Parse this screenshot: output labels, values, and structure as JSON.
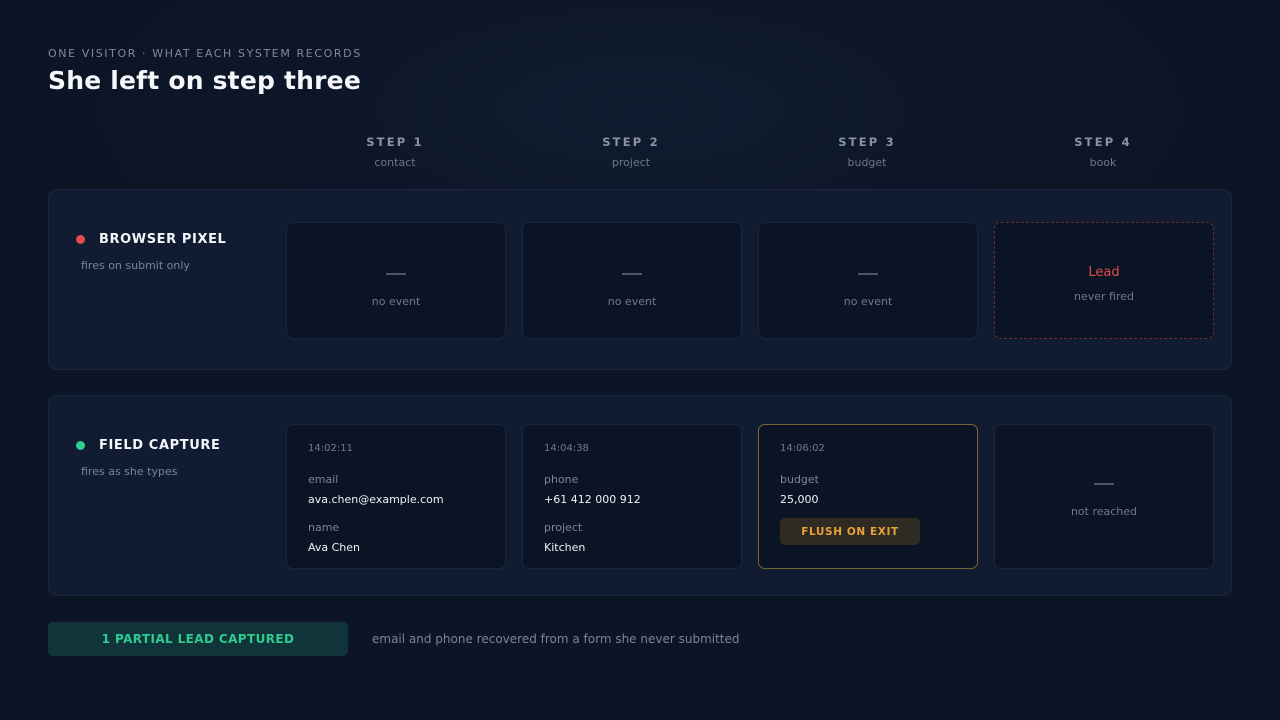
{
  "header": {
    "eyebrow": "ONE VISITOR · WHAT EACH SYSTEM RECORDS",
    "title": "She left on step three"
  },
  "steps": [
    {
      "label": "STEP 1",
      "name": "contact"
    },
    {
      "label": "STEP 2",
      "name": "project"
    },
    {
      "label": "STEP 3",
      "name": "budget"
    },
    {
      "label": "STEP 4",
      "name": "book"
    }
  ],
  "browser_pixel": {
    "name": "BROWSER PIXEL",
    "desc": "fires on submit only",
    "status_color": "#e04b4b",
    "cells": [
      {
        "dash": "—",
        "text": "no event"
      },
      {
        "dash": "—",
        "text": "no event"
      },
      {
        "dash": "—",
        "text": "no event"
      },
      {
        "event": "Lead",
        "text": "never fired"
      }
    ]
  },
  "field_capture": {
    "name": "FIELD CAPTURE",
    "desc": "fires as she types",
    "status_color": "#2ecc8f",
    "cells": [
      {
        "time": "14:02:11",
        "fields": [
          {
            "label": "email",
            "value": "ava.chen@example.com"
          },
          {
            "label": "name",
            "value": "Ava Chen"
          }
        ]
      },
      {
        "time": "14:04:38",
        "fields": [
          {
            "label": "phone",
            "value": "+61 412 000 912"
          },
          {
            "label": "project",
            "value": "Kitchen"
          }
        ]
      },
      {
        "time": "14:06:02",
        "fields": [
          {
            "label": "budget",
            "value": "25,000"
          }
        ],
        "button": "FLUSH ON EXIT"
      },
      {
        "dash": "—",
        "text": "not reached"
      }
    ]
  },
  "footer": {
    "badge": "1 PARTIAL LEAD CAPTURED",
    "summary": "email and phone recovered from a form she never submitted"
  }
}
